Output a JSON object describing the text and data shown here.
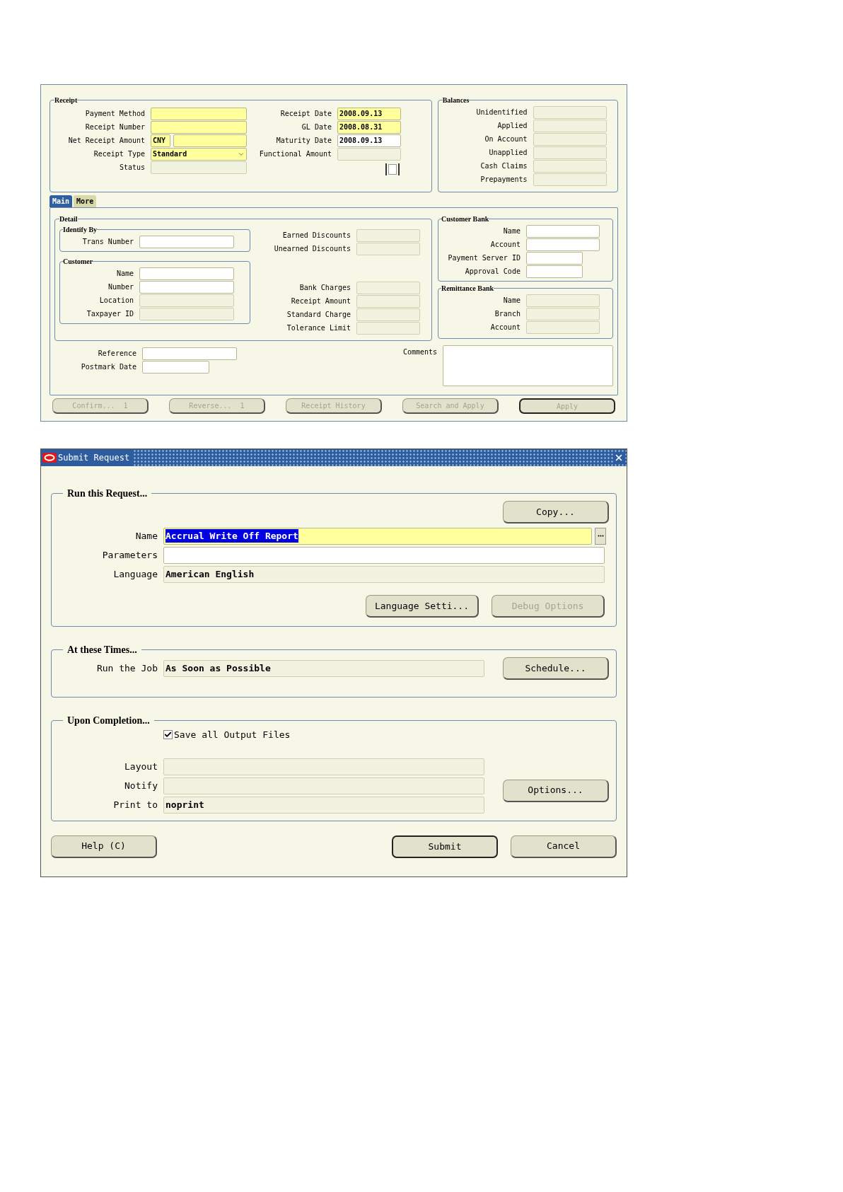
{
  "receipt_form": {
    "receipt": {
      "title": "Receipt",
      "left_fields": [
        {
          "label": "Payment Method",
          "kind": "required"
        },
        {
          "label": "Receipt Number",
          "kind": "required"
        },
        {
          "label": "Net Receipt Amount",
          "kind": "required",
          "currency": "CNY"
        },
        {
          "label": "Receipt Type",
          "kind": "select",
          "value": "Standard"
        },
        {
          "label": "Status",
          "kind": "readonly"
        }
      ],
      "right_fields": [
        {
          "label": "Receipt Date",
          "kind": "required",
          "value": "2008.09.13"
        },
        {
          "label": "GL Date",
          "kind": "required",
          "value": "2008.08.31"
        },
        {
          "label": "Maturity Date",
          "kind": "editable",
          "value": "2008.09.13"
        },
        {
          "label": "Functional Amount",
          "kind": "readonly"
        }
      ],
      "checkbox": {
        "checked": false
      }
    },
    "balances": {
      "title": "Balances",
      "fields": [
        {
          "label": "Unidentified",
          "kind": "readonly"
        },
        {
          "label": "Applied",
          "kind": "readonly"
        },
        {
          "label": "On Account",
          "kind": "readonly"
        },
        {
          "label": "Unapplied",
          "kind": "readonly"
        },
        {
          "label": "Cash Claims",
          "kind": "readonly"
        },
        {
          "label": "Prepayments",
          "kind": "readonly"
        }
      ]
    },
    "tabs": [
      {
        "label": "Main",
        "selected": true
      },
      {
        "label": "More",
        "selected": false
      }
    ],
    "detail": {
      "title": "Detail",
      "identify_by": {
        "title": "Identify By",
        "fields": [
          {
            "label": "Trans Number",
            "kind": "editable"
          }
        ]
      },
      "customer": {
        "title": "Customer",
        "fields": [
          {
            "label": "Name",
            "kind": "editable"
          },
          {
            "label": "Number",
            "kind": "editable"
          },
          {
            "label": "Location",
            "kind": "readonly"
          },
          {
            "label": "Taxpayer ID",
            "kind": "readonly"
          }
        ]
      },
      "discount_fields": [
        {
          "label": "Earned Discounts",
          "kind": "readonly"
        },
        {
          "label": "Unearned Discounts",
          "kind": "readonly"
        }
      ],
      "charge_fields": [
        {
          "label": "Bank Charges",
          "kind": "readonly"
        },
        {
          "label": "Receipt Amount",
          "kind": "readonly"
        },
        {
          "label": "Standard Charge",
          "kind": "readonly"
        },
        {
          "label": "Tolerance Limit",
          "kind": "readonly"
        }
      ]
    },
    "customer_bank": {
      "title": "Customer Bank",
      "fields": [
        {
          "label": "Name",
          "kind": "editable"
        },
        {
          "label": "Account",
          "kind": "editable"
        },
        {
          "label": "Payment Server ID",
          "kind": "editable"
        },
        {
          "label": "Approval Code",
          "kind": "editable"
        }
      ]
    },
    "remittance_bank": {
      "title": "Remittance Bank",
      "fields": [
        {
          "label": "Name",
          "kind": "readonly"
        },
        {
          "label": "Branch",
          "kind": "readonly"
        },
        {
          "label": "Account",
          "kind": "readonly"
        }
      ]
    },
    "reference_fields": [
      {
        "label": "Reference",
        "kind": "editable"
      },
      {
        "label": "Postmark Date",
        "kind": "editable"
      }
    ],
    "comments": {
      "label": "Comments"
    },
    "buttons": [
      {
        "label": "Confirm...  1",
        "disabled": true,
        "default": false
      },
      {
        "label": "Reverse...  1",
        "disabled": true,
        "default": false
      },
      {
        "label": "Receipt History",
        "disabled": true,
        "default": false
      },
      {
        "label": "Search and Apply",
        "disabled": true,
        "default": false
      },
      {
        "label": "Apply",
        "disabled": true,
        "default": true
      }
    ]
  },
  "submit_request": {
    "title": "Submit Request",
    "run_request": {
      "title": "Run this Request...",
      "copy_button": {
        "label": "Copy...",
        "disabled": false,
        "default": false
      },
      "fields": [
        {
          "label": "Name",
          "kind": "required",
          "value": "Accrual Write Off Report",
          "highlighted": true,
          "lov": true
        },
        {
          "label": "Parameters",
          "kind": "editable"
        },
        {
          "label": "Language",
          "kind": "readonly",
          "value": "American English"
        }
      ],
      "buttons": [
        {
          "label": "Language Setti...",
          "disabled": false,
          "default": false
        },
        {
          "label": "Debug Options",
          "disabled": true,
          "default": false
        }
      ]
    },
    "at_these_times": {
      "title": "At these Times...",
      "fields": [
        {
          "label": "Run the Job",
          "kind": "readonly",
          "value": "As Soon as Possible"
        }
      ],
      "button": {
        "label": "Schedule...",
        "disabled": false,
        "default": false
      }
    },
    "upon_completion": {
      "title": "Upon Completion...",
      "checkbox": {
        "label": "Save all Output Files",
        "checked": true
      },
      "fields": [
        {
          "label": "Layout",
          "kind": "readonly"
        },
        {
          "label": "Notify",
          "kind": "readonly"
        },
        {
          "label": "Print to",
          "kind": "readonly",
          "value": "noprint"
        }
      ],
      "button": {
        "label": "Options...",
        "disabled": false,
        "default": false
      }
    },
    "footer_buttons": [
      {
        "label": "Help (C)",
        "disabled": false,
        "default": false
      },
      {
        "label": "Submit",
        "disabled": false,
        "default": true
      },
      {
        "label": "Cancel",
        "disabled": false,
        "default": false
      }
    ]
  }
}
